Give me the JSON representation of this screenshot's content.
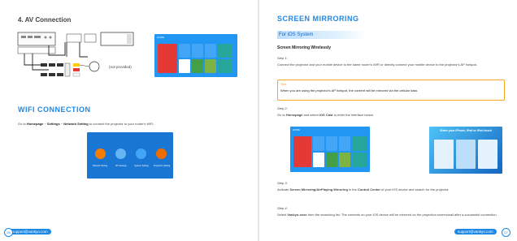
{
  "left": {
    "av_title": "4. AV Connection",
    "not_provided": "(not provided)",
    "wifi_title": "WIFI CONNECTION",
    "wifi_text_pre": "Go to ",
    "wifi_text_home": "Homepage",
    "wifi_text_settings": "Settings",
    "wifi_text_network": "Network Setting",
    "wifi_text_post": " to connect the projector to your router's WiFi.",
    "arrow": " ~ ",
    "settings_screen": {
      "labels": [
        "Network Setting",
        "BT Settings",
        "System Setting",
        "Projection Setting"
      ]
    },
    "footer_email": "support@vankyo.com",
    "page_number": "06"
  },
  "right": {
    "title": "SCREEN MIRRORING",
    "subtitle": "For iOS System",
    "heading": "Screen Mirroring Wirelessly",
    "step1_label": "Step 1:",
    "step1_text": "Connect the projector and your mobile device to the same router's WiFi or directly connect your mobile device to the projector's AP hotspot.",
    "tips_label": "Tips",
    "tips_text": "When you are using the projector's AP hotspot, the content will be mirrored via the cellular data.",
    "step2_label": "Step 2:",
    "step2_pre": "Go to ",
    "step2_home": "Homepage",
    "step2_mid": " and select ",
    "step2_ios": "iOS Cast",
    "step2_post": " to enter the interface below.",
    "photo_caption": "Share your iPhone, iPad or iPod touch",
    "step3_label": "Step 3:",
    "step3_pre": "Activate ",
    "step3_bold1": "Screen Mirroring/AirPlaying Mirroring",
    "step3_mid": " in the ",
    "step3_bold2": "Control Center",
    "step3_post": " of your iOS device and search for the projector.",
    "step4_label": "Step 4:",
    "step4_pre": "Select ",
    "step4_bold": "Vankyo-xxxx",
    "step4_post": " from the searching list. The contents on your iOS device will be mirrored on the projection screen/wall after a successful connection.",
    "footer_email": "support@vankyo.com",
    "page_number": "07"
  },
  "home_screen": {
    "header": "HOME"
  },
  "colors": {
    "accent": "#1e88e5",
    "tips_border": "#f5a623",
    "tile_red": "#e53935",
    "tile_green": "#43a047",
    "tile_teal": "#26a69a",
    "tile_lime": "#7cb342"
  }
}
